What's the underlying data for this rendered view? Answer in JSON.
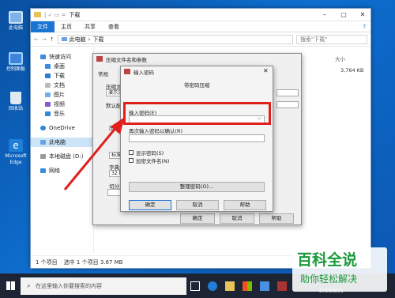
{
  "desktop": {
    "icons": [
      "此电脑",
      "控制面板",
      "回收站",
      "Microsoft Edge"
    ]
  },
  "explorer": {
    "title": "下载",
    "ribbon_tabs": [
      "文件",
      "主页",
      "共享",
      "查看"
    ],
    "address": {
      "root": "此电脑",
      "current": "下载"
    },
    "search_placeholder": "搜索\"下载\"",
    "column_size": "大小",
    "file_size": "3,764 KB",
    "nav": [
      "快速访问",
      "桌面",
      "下载",
      "文档",
      "图片",
      "视频",
      "音乐",
      "OneDrive",
      "此电脑",
      "本地磁盘 (D:)",
      "网络"
    ],
    "status": {
      "count": "1 个项目",
      "selected": "选中 1 个项目 3.67 MB"
    }
  },
  "archive_dialog": {
    "title": "压缩文件名和参数",
    "tab": "常规",
    "left_labels": [
      "压缩文",
      "演示文",
      "默认配",
      "压缩",
      "标准",
      "字典大",
      "32 MB",
      "切分为"
    ],
    "buttons": {
      "ok": "确定",
      "cancel": "取消",
      "help": "帮助"
    }
  },
  "password_dialog": {
    "title": "输入密码",
    "subtitle": "带密码压缩",
    "enter_label": "输入密码(E)",
    "reenter_label": "再次输入密码以确认(R)",
    "show_password": "显示密码(S)",
    "encrypt_names": "加密文件名(N)",
    "organize_button": "整理密码(O)...",
    "buttons": {
      "ok": "确定",
      "cancel": "取消",
      "help": "帮助"
    }
  },
  "taskbar": {
    "search_placeholder": "在这里输入你要搜索的内容",
    "date": "2019/8/31"
  },
  "watermark": {
    "line1": "百科全说",
    "line2": "助你轻松解决"
  },
  "colors": {
    "accent": "#1a74d2",
    "highlight": "#e0201e",
    "watermark_green": "#1a9a3a"
  }
}
